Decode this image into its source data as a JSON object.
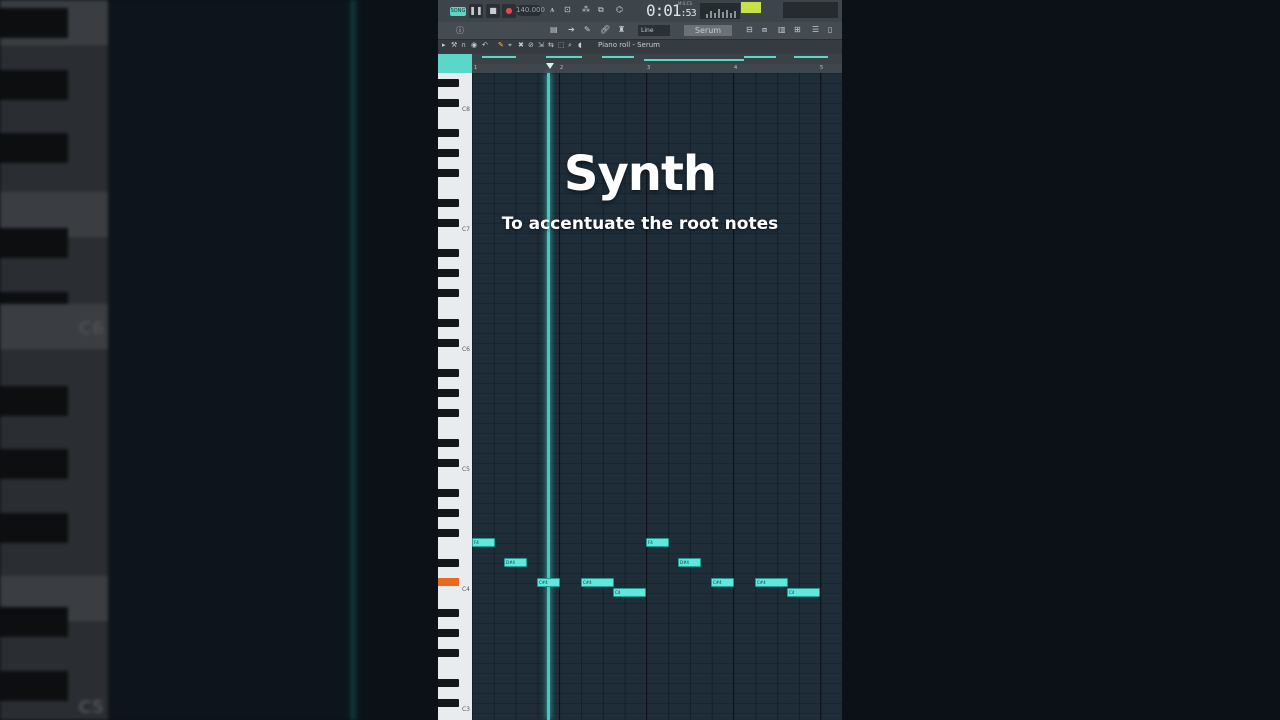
{
  "overlay": {
    "title": "Synth",
    "subtitle": "To accentuate the root notes"
  },
  "transport": {
    "pattern_label": "SONG",
    "tempo": "140.000",
    "time_main": "0:01",
    "time_sub": ":53",
    "time_tag": "M:S:CS"
  },
  "toolbar": {
    "snap_mode": "Line",
    "instrument": "Serum",
    "piano_roll_title": "Piano roll - Serum"
  },
  "ruler": {
    "bars": [
      "1",
      "2",
      "3",
      "4",
      "5"
    ]
  },
  "keys": {
    "labels": [
      "C8",
      "C7",
      "C6",
      "C5",
      "C4",
      "C3"
    ]
  },
  "background": {
    "label_c6": "C6",
    "label_c5": "C5"
  },
  "notes": [
    {
      "label": "F4"
    },
    {
      "label": "D#4"
    },
    {
      "label": "C#4"
    },
    {
      "label": "C#4"
    },
    {
      "label": "C4"
    },
    {
      "label": "F4"
    },
    {
      "label": "D#4"
    },
    {
      "label": "C#4"
    },
    {
      "label": "C#4"
    },
    {
      "label": "C4"
    }
  ],
  "colors": {
    "accent": "#5ad7c8",
    "note_fill": "#63e7dc",
    "active_key": "#e86a1e",
    "grid_bg": "#1f2d39"
  }
}
